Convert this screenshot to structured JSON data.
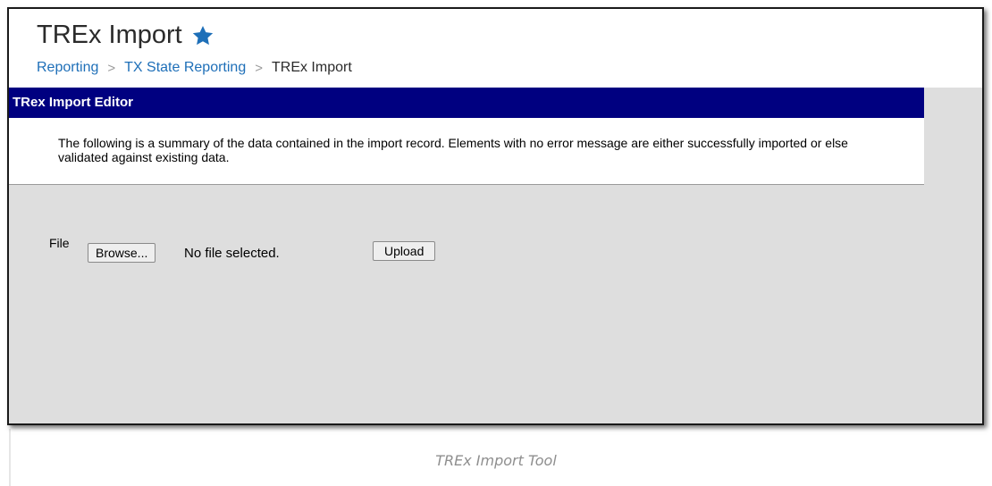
{
  "header": {
    "title": "TREx Import",
    "favorite_icon": "star-icon",
    "star_color": "#1e6fb8"
  },
  "breadcrumb": {
    "items": [
      "Reporting",
      "TX State Reporting",
      "TREx Import"
    ],
    "separator": ">"
  },
  "editor": {
    "title": "TRex Import Editor",
    "title_bar_color": "#000080",
    "description": "The following is a summary of the data contained in the import record. Elements with no error message are either successfully imported or else validated against existing data."
  },
  "file_upload": {
    "label": "File",
    "browse_label": "Browse...",
    "status": "No file selected.",
    "upload_label": "Upload"
  },
  "caption": "TREx Import Tool"
}
